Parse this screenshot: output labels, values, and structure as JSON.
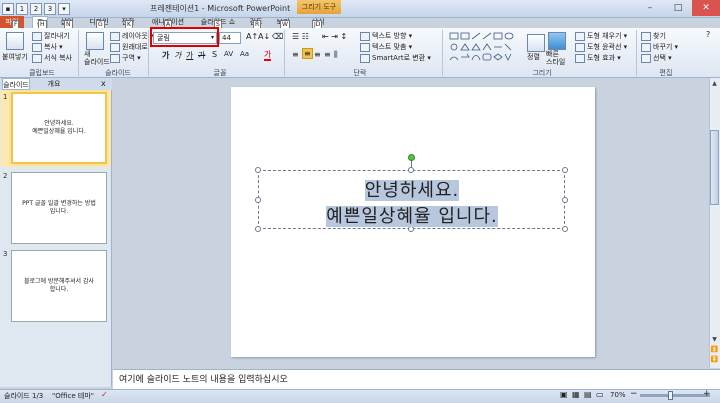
{
  "app": {
    "title": "프레젠테이션1 - Microsoft PowerPoint",
    "tools_header": "그리기 도구",
    "tools_header_key": "JD",
    "qat_keys": [
      "1",
      "2",
      "3"
    ]
  },
  "window": {
    "minimize": "–",
    "maximize": "□",
    "close": "✕"
  },
  "tabs": [
    {
      "label": "파일",
      "key": "F"
    },
    {
      "label": "홈",
      "key": "H"
    },
    {
      "label": "삽입",
      "key": "N"
    },
    {
      "label": "디자인",
      "key": "G"
    },
    {
      "label": "전환",
      "key": "K"
    },
    {
      "label": "애니메이션",
      "key": "A"
    },
    {
      "label": "슬라이드 쇼",
      "key": "S"
    },
    {
      "label": "검토",
      "key": "R"
    },
    {
      "label": "보기",
      "key": "W"
    },
    {
      "label": "서식",
      "key": "JD"
    }
  ],
  "ribbon": {
    "clipboard": {
      "label": "클립보드",
      "paste": "붙여넣기",
      "cut": "잘라내기",
      "copy": "복사 ▾",
      "format_painter": "서식 복사"
    },
    "slides": {
      "label": "슬라이드",
      "new_slide": "새\n슬라이드",
      "layout": "레이아웃 ▾",
      "reset": "원래대로",
      "section": "구역 ▾"
    },
    "font": {
      "label": "글꼴",
      "font_name": "굴림",
      "font_size": "44",
      "bold": "가",
      "italic": "가",
      "underline": "가",
      "strike": "가",
      "shadow": "S",
      "spacing": "AV",
      "case": "Aa",
      "color": "가"
    },
    "paragraph": {
      "label": "단락",
      "text_direction": "텍스트 방향 ▾",
      "align_text": "텍스트 맞춤 ▾",
      "smartart": "SmartArt로 변환 ▾"
    },
    "drawing": {
      "label": "그리기",
      "arrange": "정렬",
      "quick_styles": "빠른\n스타일",
      "fill": "도형 채우기 ▾",
      "outline": "도형 윤곽선 ▾",
      "effects": "도형 효과 ▾"
    },
    "editing": {
      "label": "편집",
      "find": "찾기",
      "replace": "바꾸기 ▾",
      "select": "선택 ▾"
    }
  },
  "pane": {
    "tab_slides": "슬라이드",
    "tab_outline": "개요",
    "close": "x",
    "thumbs": [
      {
        "num": "1",
        "lines": [
          "안녕하세요.",
          "예쁜일상혜율 입니다."
        ]
      },
      {
        "num": "2",
        "lines": [
          "PPT 글꼴 일괄 변경하는 방법",
          "입니다."
        ]
      },
      {
        "num": "3",
        "lines": [
          "블로그에 방문해주셔서 감사",
          "합니다."
        ]
      }
    ]
  },
  "slide": {
    "line1": "안녕하세요.",
    "line2": "예쁜일상혜율 입니다."
  },
  "notes": {
    "placeholder": "여기에 슬라이드 노트의 내용을 입력하십시오"
  },
  "status": {
    "slide_count": "슬라이드 1/3",
    "theme": "\"Office 테마\"",
    "zoom": "70%",
    "zoom_level_percent": 70
  }
}
